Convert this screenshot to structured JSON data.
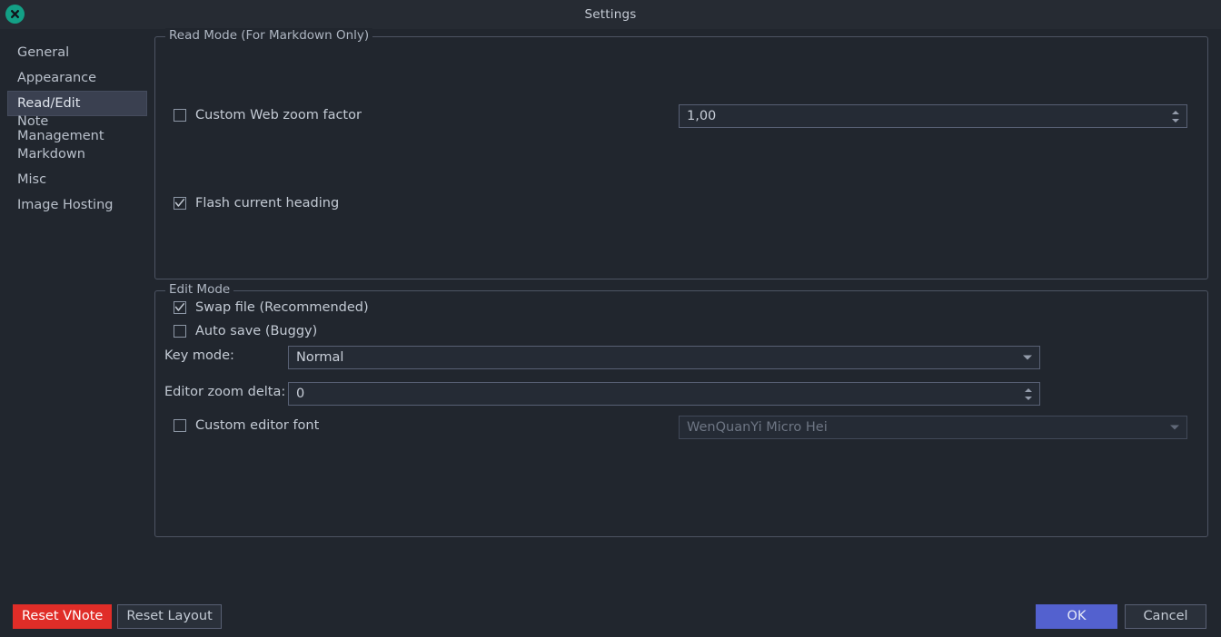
{
  "window": {
    "title": "Settings",
    "close_icon": "close-circle-icon"
  },
  "sidebar": {
    "items": [
      {
        "label": "General",
        "selected": false
      },
      {
        "label": "Appearance",
        "selected": false
      },
      {
        "label": "Read/Edit",
        "selected": true
      },
      {
        "label": "Note Management",
        "selected": false
      },
      {
        "label": "Markdown",
        "selected": false
      },
      {
        "label": "Misc",
        "selected": false
      },
      {
        "label": "Image Hosting",
        "selected": false
      }
    ]
  },
  "read_mode": {
    "group_title": "Read Mode (For Markdown Only)",
    "custom_web_zoom": {
      "label": "Custom Web zoom factor",
      "checked": false,
      "value": "1,00",
      "spin_up_icon": "triangle-up-icon",
      "spin_down_icon": "triangle-down-icon"
    },
    "flash_heading": {
      "label": "Flash current heading",
      "checked": true
    }
  },
  "edit_mode": {
    "group_title": "Edit Mode",
    "swap_file": {
      "label": "Swap file (Recommended)",
      "checked": true
    },
    "auto_save": {
      "label": "Auto save (Buggy)",
      "checked": false
    },
    "key_mode": {
      "label": "Key mode:",
      "value": "Normal",
      "arrow_icon": "chevron-down-icon"
    },
    "editor_zoom_delta": {
      "label": "Editor zoom delta:",
      "value": "0",
      "spin_up_icon": "triangle-up-icon",
      "spin_down_icon": "triangle-down-icon"
    },
    "custom_editor_font": {
      "label": "Custom editor font",
      "checked": false,
      "value": "WenQuanYi Micro Hei",
      "disabled": true,
      "arrow_icon": "chevron-down-icon"
    }
  },
  "footer": {
    "reset_vnote": "Reset VNote",
    "reset_layout": "Reset Layout",
    "ok": "OK",
    "cancel": "Cancel"
  },
  "colors": {
    "window_bg": "#21262e",
    "titlebar_bg": "#262b33",
    "accent_primary": "#5361cf",
    "accent_danger": "#e02d28",
    "close_button": "#13a086",
    "selection_bg": "#3a4050",
    "border": "#4d5463",
    "text": "#c3cad4"
  }
}
